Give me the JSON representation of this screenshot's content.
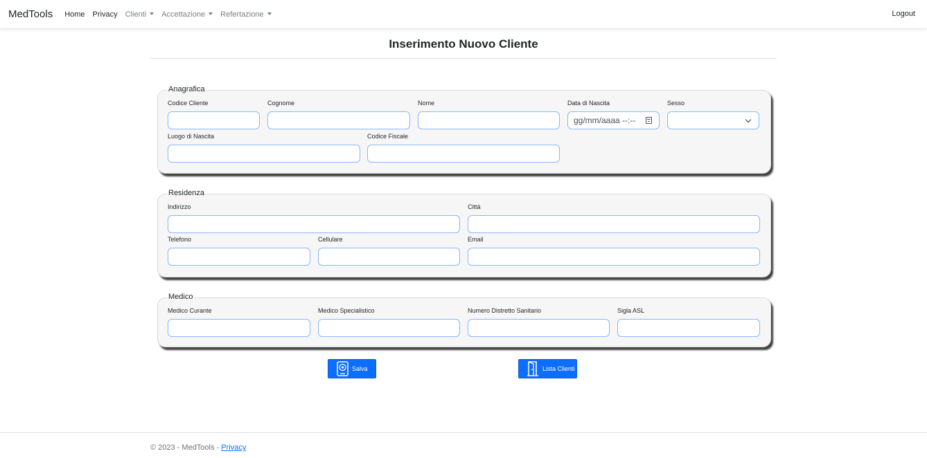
{
  "nav": {
    "brand": "MedTools",
    "home": "Home",
    "privacy": "Privacy",
    "clienti": "Clienti",
    "accettazione": "Accettazione",
    "refertazione": "Refertazione",
    "logout": "Logout"
  },
  "page": {
    "title": "Inserimento Nuovo Cliente"
  },
  "anagrafica": {
    "legend": "Anagrafica",
    "codice_cliente": "Codice Cliente",
    "cognome": "Cognome",
    "nome": "Nome",
    "data_nascita": "Data di Nascita",
    "data_placeholder": "gg/mm/aaaa --:--",
    "sesso": "Sesso",
    "luogo_nascita": "Luogo di Nascita",
    "codice_fiscale": "Codice Fiscale"
  },
  "residenza": {
    "legend": "Residenza",
    "indirizzo": "Indirizzo",
    "citta": "Città",
    "telefono": "Telefono",
    "cellulare": "Cellulare",
    "email": "Email"
  },
  "medico": {
    "legend": "Medico",
    "curante": "Medico Curante",
    "specialistico": "Medico Specialistico",
    "distretto": "Numero Distretto Sanitario",
    "asl": "Sigla ASL"
  },
  "actions": {
    "salva": "Salva",
    "lista": "Lista Clienti"
  },
  "footer": {
    "copyright": "© 2023 - MedTools - ",
    "privacy": "Privacy"
  },
  "colors": {
    "primary": "#0d6efd",
    "input_border": "#86b7fe",
    "panel_bg": "#f6f6f6"
  }
}
